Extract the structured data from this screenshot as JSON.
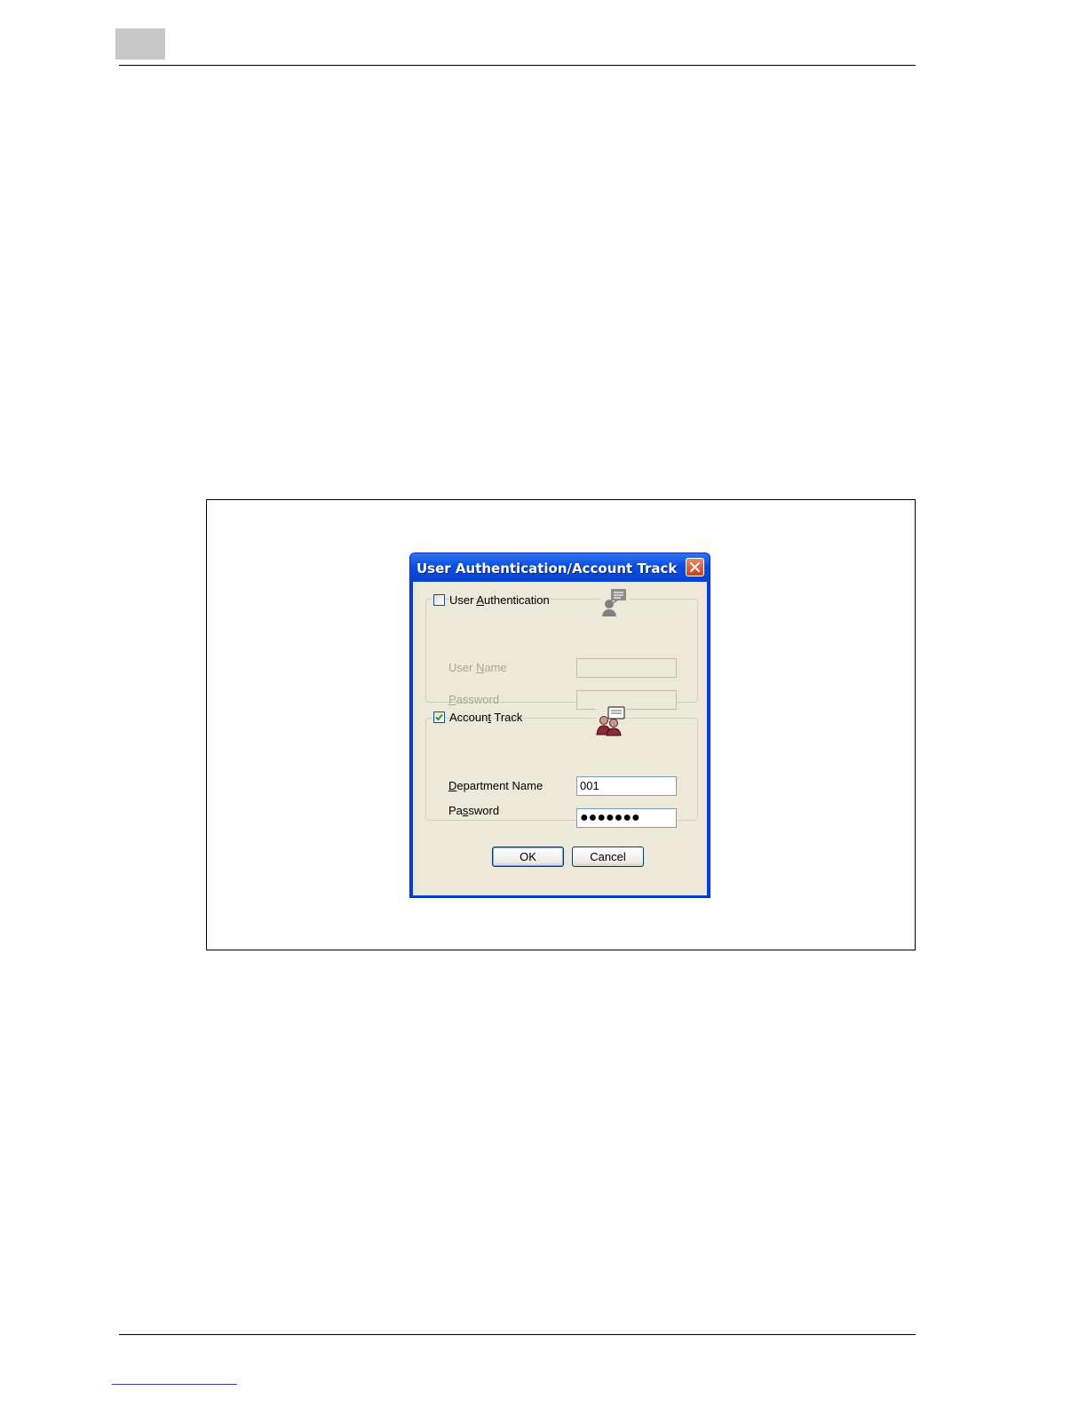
{
  "dialog": {
    "title": "User Authentication/Account Track",
    "user_authentication": {
      "checkbox_label_pre": "User ",
      "checkbox_label_key": "A",
      "checkbox_label_post": "uthentication",
      "checked": false,
      "user_name_label_pre": "User ",
      "user_name_label_key": "N",
      "user_name_label_post": "ame",
      "user_name_value": "",
      "password_label_key": "P",
      "password_label_post": "assword",
      "password_value": "",
      "icon": "user-speech-icon"
    },
    "account_track": {
      "checkbox_label_pre": "Accoun",
      "checkbox_label_key": "t",
      "checkbox_label_post": " Track",
      "checked": true,
      "department_label_key": "D",
      "department_label_post": "epartment Name",
      "department_value": "001",
      "password_label_pre": "Pa",
      "password_label_key": "s",
      "password_label_post": "sword",
      "password_masked": "●●●●●●●",
      "icon": "group-speech-icon"
    },
    "buttons": {
      "ok": "OK",
      "cancel": "Cancel"
    }
  }
}
